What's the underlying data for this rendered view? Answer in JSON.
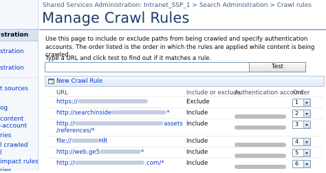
{
  "breadcrumb": {
    "part1": "Shared Services Administration: Intranet_SSP_1",
    "sep1": " > ",
    "part2": "Search Administration",
    "sep2": " > ",
    "part3": "Crawl rules"
  },
  "page_title": "Manage Crawl Rules",
  "description": "Use this page to include or exclude paths from being crawled and specify authentication accounts.  The order listed is the order in which the rules are applied while content is being crawled.",
  "test_url": {
    "label": "Type a URL and click test to find out if it matches a rule.",
    "value": "",
    "button_label": "Test"
  },
  "sidebar": {
    "header": "stration",
    "items": [
      "stration",
      "stration",
      "t sources",
      "og",
      "content",
      "-account",
      "ries",
      "l crawled",
      "l",
      "impact rules",
      "ries"
    ]
  },
  "toolbar": {
    "new_rule_label": "New Crawl Rule"
  },
  "columns": [
    "URL",
    "Include or exclude",
    "Authentication account",
    "Order"
  ],
  "rules": [
    {
      "url_prefix": "https://",
      "url_suffix": "",
      "include": "Exclude",
      "order": "1"
    },
    {
      "url_prefix": "http://searchinside",
      "url_suffix": "*",
      "include": "Include",
      "order": "2"
    },
    {
      "url_prefix": "http://",
      "url_suffix": "assets",
      "url_line2": "/references/*",
      "include": "Include",
      "order": "3"
    },
    {
      "url_prefix": "file://",
      "url_suffix": "HR",
      "include": "Include",
      "order": "4"
    },
    {
      "url_prefix": "http://web.ge5",
      "url_suffix": "*",
      "include": "Include",
      "order": "5"
    },
    {
      "url_prefix": "http://",
      "url_suffix": ".com/*",
      "include": "Include",
      "order": "6"
    }
  ],
  "colors": {
    "title": "#1d3e6e",
    "link": "#0033cc",
    "sidebar_bg": "#f4f7fb",
    "toolbar_bg": "#dfe9f5"
  }
}
